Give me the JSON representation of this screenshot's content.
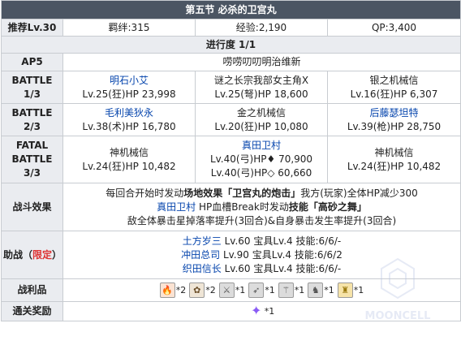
{
  "title": "第五节 必杀的卫宫丸",
  "recommend": "推荐Lv.30",
  "bond": "羁绊:315",
  "exp": "经验:2,190",
  "qp": "QP:3,400",
  "progress": "进行度 1/1",
  "ap": {
    "label": "AP5",
    "value": "唠唠叨叨明治维新"
  },
  "battles": [
    {
      "label_lines": [
        "BATTLE",
        "1/3"
      ],
      "enemies": [
        {
          "name": "明石小艾",
          "link": true,
          "stats": "Lv.25(狂)HP 23,998"
        },
        {
          "name": "谜之长宗我部女主角X",
          "link": false,
          "stats": "Lv.25(弩)HP 18,600"
        },
        {
          "name": "银之机械信",
          "link": false,
          "stats": "Lv.16(狂)HP 6,307"
        }
      ]
    },
    {
      "label_lines": [
        "BATTLE",
        "2/3"
      ],
      "enemies": [
        {
          "name": "毛利美狄永",
          "link": true,
          "stats": "Lv.38(术)HP 16,780"
        },
        {
          "name": "金之机械信",
          "link": false,
          "stats": "Lv.20(狂)HP 10,080"
        },
        {
          "name": "后藤瑟坦特",
          "link": true,
          "stats": "Lv.39(枪)HP 28,750"
        }
      ]
    },
    {
      "label_lines": [
        "FATAL",
        "BATTLE",
        "3/3"
      ],
      "enemies": [
        {
          "name": "神机械信",
          "link": false,
          "stats": "Lv.24(狂)HP 10,482"
        },
        {
          "name": "真田卫村",
          "link": true,
          "stats": "Lv.40(弓)HP♦ 70,900",
          "stats2": "Lv.40(弓)HP◇ 60,660"
        },
        {
          "name": "神机械信",
          "link": false,
          "stats": "Lv.24(狂)HP 10,482"
        }
      ]
    }
  ],
  "effects": {
    "label": "战斗效果",
    "line1_a": "每回合开始时发动",
    "line1_b": "场地效果「卫宫丸的炮击」",
    "line1_c": "我方(玩家)全体HP减少300",
    "line2_name": "真田卫村",
    "line2_a": " HP血槽Break时发动",
    "line2_b": "技能「高砂之舞」",
    "line3": "敌全体暴击星掉落率提升(3回合)&自身暴击发生率提升(3回合)"
  },
  "support": {
    "label_a": "助战（",
    "label_b": "限定",
    "label_c": "）",
    "members": [
      {
        "name": "土方岁三",
        "stats": " Lv.60 宝具Lv.4 技能:6/6/-"
      },
      {
        "name": "冲田总司",
        "stats": " Lv.90 宝具Lv.4 技能:6/6/2"
      },
      {
        "name": "织田信长",
        "stats": " Lv.60 宝具Lv.4 技能:6/6/-"
      }
    ]
  },
  "drops": {
    "label": "战利品",
    "items": [
      {
        "icon": "fire-material-icon",
        "glyph": "🔥",
        "count": "*2"
      },
      {
        "icon": "seed-material-icon",
        "glyph": "✿",
        "count": "*2"
      },
      {
        "icon": "saber-piece-icon",
        "glyph": "⚔",
        "count": "*1"
      },
      {
        "icon": "archer-piece-icon",
        "glyph": "➶",
        "count": "*1"
      },
      {
        "icon": "lancer-piece-icon",
        "glyph": "⚚",
        "count": "*1"
      },
      {
        "icon": "rider-piece-icon",
        "glyph": "♞",
        "count": "*1"
      },
      {
        "icon": "gold-monument-icon",
        "glyph": "♜",
        "count": "*1"
      }
    ]
  },
  "clear": {
    "label": "通关奖励",
    "icon": "saint-quartz-icon",
    "glyph": "✦",
    "count": "*1"
  },
  "watermark_text": "MOONCELL"
}
